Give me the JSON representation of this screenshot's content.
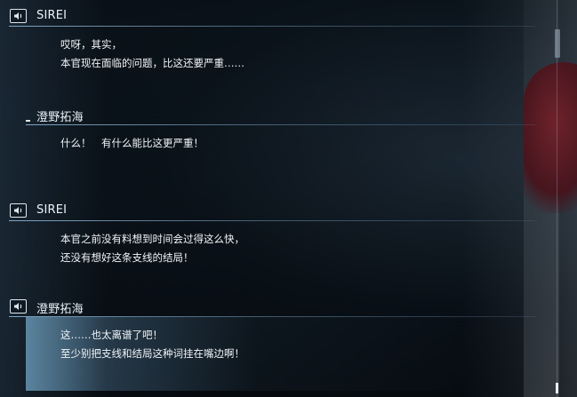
{
  "backlog": {
    "entries": [
      {
        "speaker": "SIREI",
        "has_voice": true,
        "lines": [
          "哎呀，其实，",
          "本官现在面临的问题，比这还要严重……"
        ]
      },
      {
        "speaker": "澄野拓海",
        "has_voice": false,
        "lines": [
          "什么！　有什么能比这更严重！"
        ]
      },
      {
        "speaker": "SIREI",
        "has_voice": true,
        "lines": [
          "本官之前没有料想到时间会过得这么快，",
          "还没有想好这条支线的结局！"
        ]
      },
      {
        "speaker": "澄野拓海",
        "has_voice": true,
        "lines": [
          "这……也太离谱了吧！",
          "至少别把支线和结局这种词挂在嘴边啊！"
        ]
      }
    ]
  },
  "scroll": {
    "position": 1.0
  },
  "colors": {
    "accent": "#8cb4d2",
    "text": "#f0f4f8",
    "highlight": "#6896b4"
  }
}
